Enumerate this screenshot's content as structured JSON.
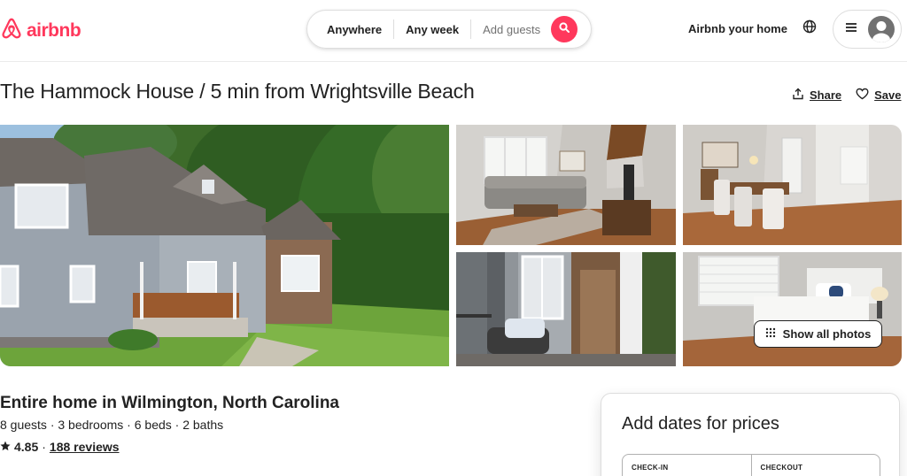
{
  "brand": {
    "name": "airbnb",
    "color": "#ff385c"
  },
  "search": {
    "location": "Anywhere",
    "dates": "Any week",
    "guests_placeholder": "Add guests"
  },
  "nav": {
    "host_link": "Airbnb your home"
  },
  "listing": {
    "title": "The Hammock House / 5 min from Wrightsville Beach",
    "share_label": "Share",
    "save_label": "Save",
    "show_all_photos": "Show all photos",
    "home_type": "Entire home in Wilmington, North Carolina",
    "specs": "8 guests · 3 bedrooms · 6 beds · 2 baths",
    "rating": "4.85",
    "rating_separator": "·",
    "reviews": "188 reviews"
  },
  "booking": {
    "title": "Add dates for prices",
    "checkin_label": "CHECK-IN",
    "checkout_label": "CHECKOUT"
  },
  "icons": {
    "logo": "airbnb-logo-icon",
    "search": "search-icon",
    "globe": "globe-icon",
    "menu": "hamburger-menu-icon",
    "avatar": "user-avatar-icon",
    "share": "share-icon",
    "save": "heart-icon",
    "grid": "grid-dots-icon",
    "star": "star-icon"
  }
}
